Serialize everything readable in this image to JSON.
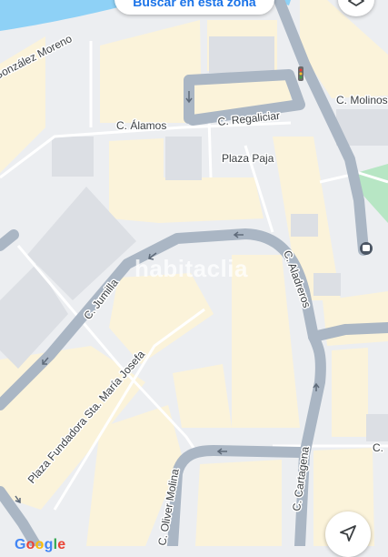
{
  "map": {
    "streets": {
      "gonzalez_moreno": "C. González Moreno",
      "alamos": "C. Álamos",
      "regaliciar": "C. Regaliciar",
      "molinos": "C. Molinos",
      "plaza_paja": "Plaza Paja",
      "jumilla": "C. Jumilla",
      "aladreros": "C. Aladreros",
      "plaza_fundadora": "Plaza Fundadora Sta. María Josefa",
      "cartagena": "C. Cartagena",
      "oliver_molina": "C. Oliver Molina",
      "right_edge": "C."
    }
  },
  "search_area_button": {
    "label": "Buscar en esta zona"
  },
  "watermark": "habitaclia",
  "google_logo": "Google",
  "icons": {
    "layers": "layers-icon",
    "locate": "navigation-arrow-icon",
    "traffic_light": "traffic-light-icon",
    "bus_stop": "bus-stop-icon"
  },
  "colors": {
    "water": "#8ed1f6",
    "road": "#aab6c4",
    "block": "#fbf3da",
    "park": "#b7e6c4",
    "background": "#eceef1",
    "accent": "#1a73e8"
  }
}
